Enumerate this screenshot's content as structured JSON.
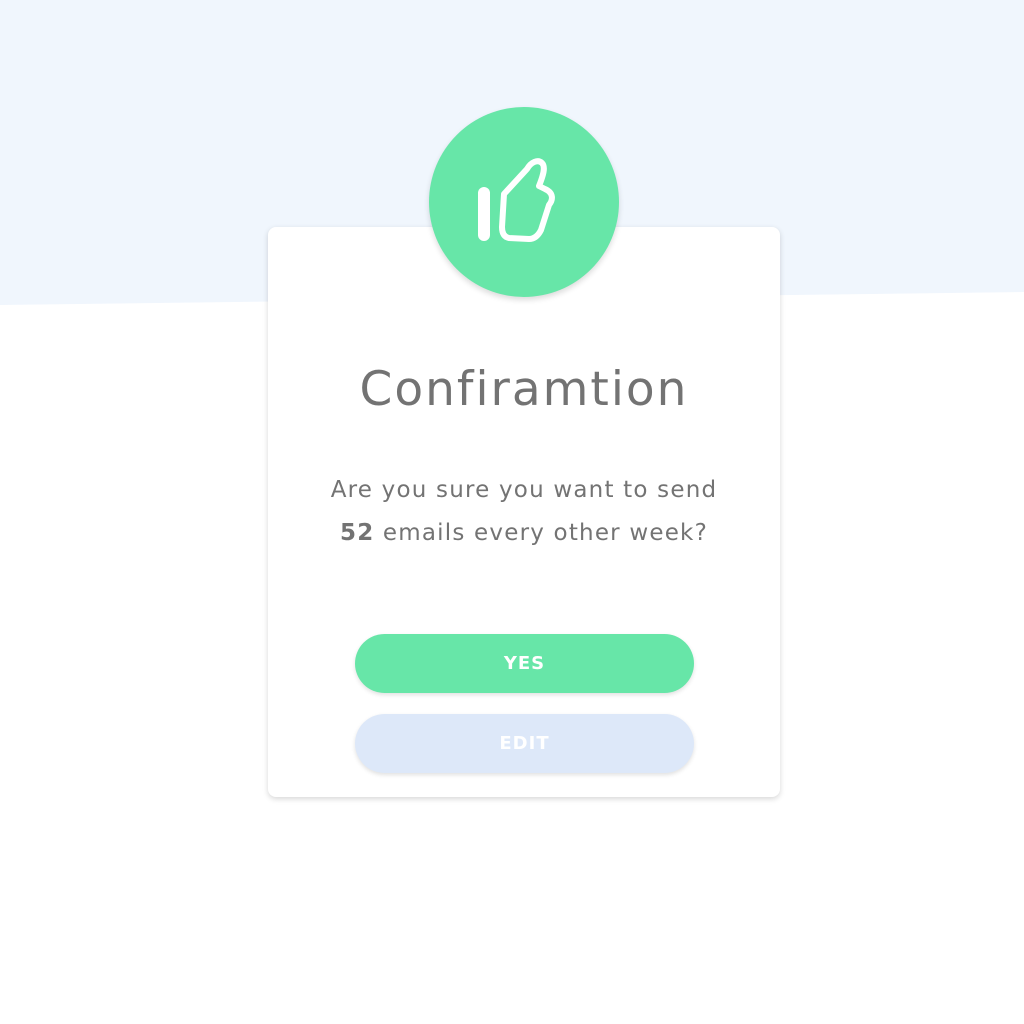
{
  "dialog": {
    "title": "Confiramtion",
    "message_before": "Are you sure you want to send ",
    "message_count": "52",
    "message_after": " emails every other week?",
    "badge_icon": "thumbs-up-icon"
  },
  "buttons": {
    "yes_label": "YES",
    "edit_label": "EDIT"
  },
  "colors": {
    "page_background": "#ffffff",
    "top_band": "#f0f6fd",
    "accent_green": "#67e6a8",
    "edit_button": "#dde8f9",
    "text_gray": "#737373"
  }
}
